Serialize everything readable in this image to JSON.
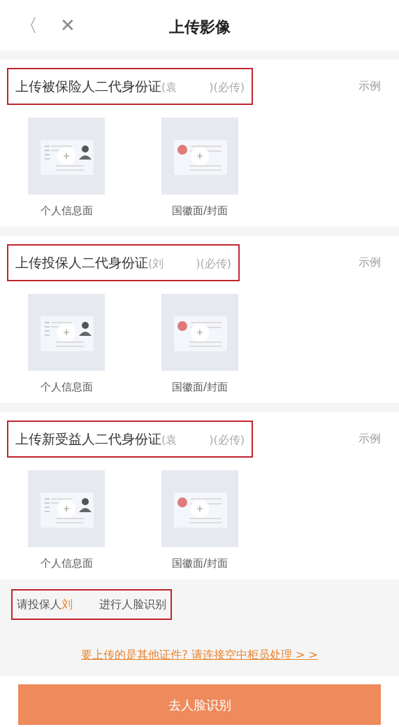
{
  "header": {
    "back": "〈",
    "close": "✕",
    "title": "上传影像"
  },
  "sections": [
    {
      "title": "上传被保险人二代身份证",
      "name_hint": "(袁",
      "required_hint": ")(必传)",
      "example": "示例",
      "highlighted": true,
      "tiles": [
        {
          "kind": "portrait",
          "label": "个人信息面"
        },
        {
          "kind": "emblem",
          "label": "国徽面/封面"
        }
      ]
    },
    {
      "title": "上传投保人二代身份证",
      "name_hint": "(刘",
      "required_hint": ")(必传)",
      "example": "示例",
      "highlighted": true,
      "tiles": [
        {
          "kind": "portrait",
          "label": "个人信息面"
        },
        {
          "kind": "emblem",
          "label": "国徽面/封面"
        }
      ]
    },
    {
      "title": "上传新受益人二代身份证",
      "name_hint": "(袁",
      "required_hint": ")(必传)",
      "example": "示例",
      "highlighted": true,
      "tiles": [
        {
          "kind": "portrait",
          "label": "个人信息面"
        },
        {
          "kind": "emblem",
          "label": "国徽面/封面"
        }
      ]
    }
  ],
  "face_prompt": {
    "before": "请投保人",
    "name": "刘",
    "after": "进行人脸识别",
    "highlighted": true
  },
  "other_link": "要上传的是其他证件? 请连接空中柜员处理 > >",
  "face_button": {
    "label": "去人脸识别",
    "disabled": true
  }
}
